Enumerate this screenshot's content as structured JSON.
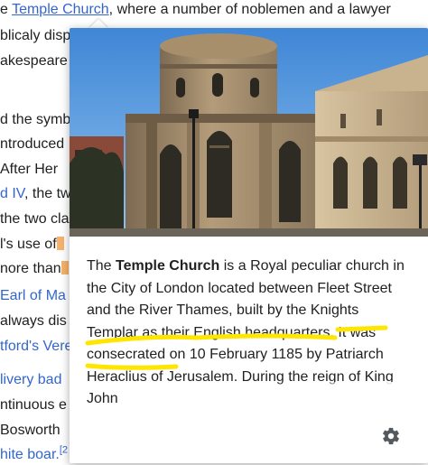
{
  "article": {
    "line1_prefix": "e ",
    "line1_link": "Temple Church",
    "line1_suffix": ", where a number of noblemen and a lawyer",
    "line2": "blicaly disp",
    "line3": "akespeare",
    "line5": "d the symb",
    "line6": "ntroduced",
    "line7": " After Her",
    "line8_link": "d IV",
    "line8_suffix": ", the tw",
    "line9": "the two cla",
    "line10": "l's use of",
    "line11": "nore than",
    "line12_link": "Earl of Ma",
    "line13": "always dis",
    "line14_link": "tford's Vere",
    "line16_link": "livery bad",
    "line17": "ntinuous e",
    "line18": "Bosworth",
    "line19_link": "hite boar.",
    "line19_sup": "[2"
  },
  "popup": {
    "image_alt": "Temple Church",
    "title_bold": "Temple Church",
    "intro": "The ",
    "text1": " is a Royal peculiar church in the City of London located between Fleet Street and the River Thames, ",
    "hl_text": "built by the Knights Templar as their English headquarters",
    "text2": ". It was consecrated on 10 February 1185 by Patriarch Heraclius of Jerusalem. During the reign of King John",
    "settings_icon": "gear-icon",
    "highlight_color": "#ffe600"
  }
}
